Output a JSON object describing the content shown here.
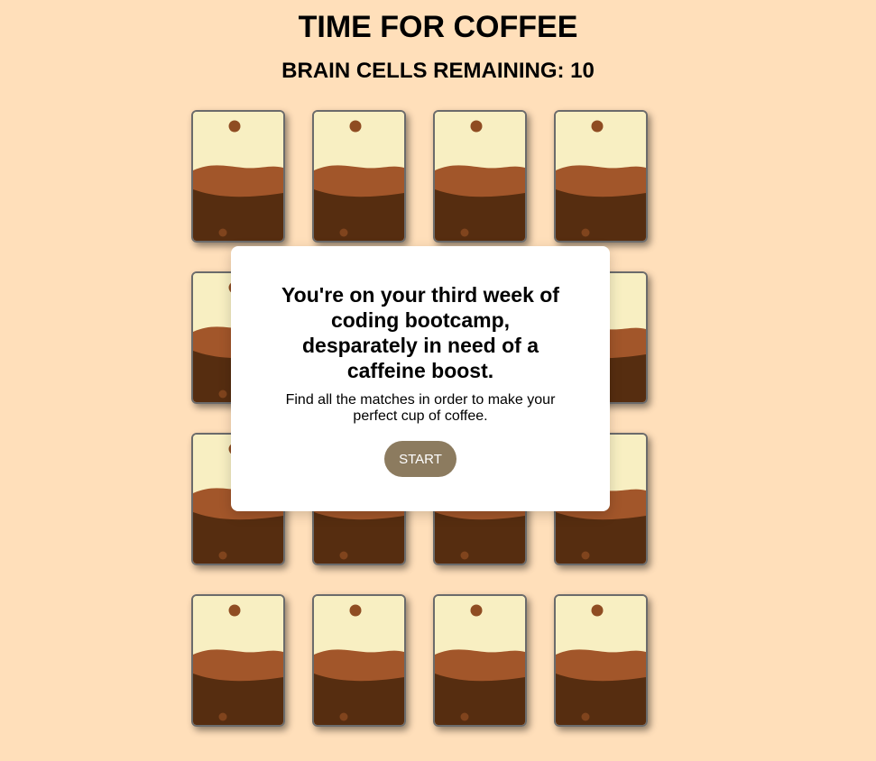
{
  "header": {
    "title": "TIME FOR COFFEE",
    "brain_cells_label": "BRAIN CELLS REMAINING: 10"
  },
  "board": {
    "rows": 4,
    "columns": 4,
    "card_count": 16,
    "card_face": "coffee-cup-card-back"
  },
  "modal": {
    "heading": "You're on your third week of coding bootcamp, desparately in need of a caffeine boost.",
    "text": "Find all the matches in order to make your perfect cup of coffee.",
    "start_label": "START"
  },
  "colors": {
    "background": "#ffdfba",
    "card_top": "#f8efc2",
    "card_foam": "#a2562a",
    "card_coffee": "#562d10",
    "card_bean": "#8f4c22",
    "start_button": "#8c7b5f"
  }
}
